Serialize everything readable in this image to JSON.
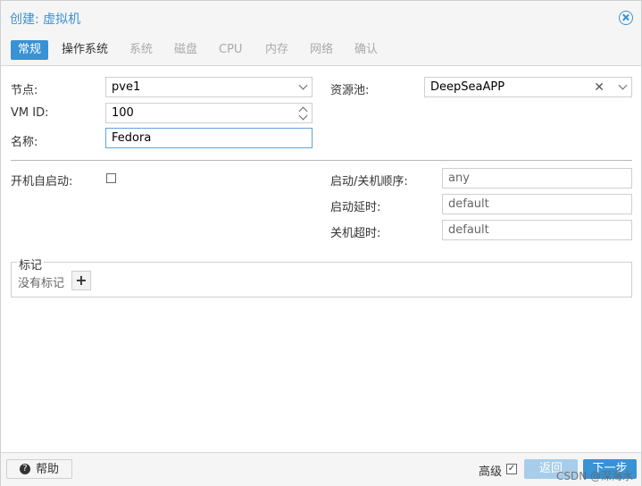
{
  "dialog": {
    "title": "创建: 虚拟机"
  },
  "tabs": [
    {
      "label": "常规",
      "state": "active"
    },
    {
      "label": "操作系统",
      "state": "enabled"
    },
    {
      "label": "系统",
      "state": "disabled"
    },
    {
      "label": "磁盘",
      "state": "disabled"
    },
    {
      "label": "CPU",
      "state": "disabled"
    },
    {
      "label": "内存",
      "state": "disabled"
    },
    {
      "label": "网络",
      "state": "disabled"
    },
    {
      "label": "确认",
      "state": "disabled"
    }
  ],
  "form": {
    "node_label": "节点:",
    "node_value": "pve1",
    "vmid_label": "VM ID:",
    "vmid_value": "100",
    "name_label": "名称:",
    "name_value": "Fedora",
    "pool_label": "资源池:",
    "pool_value": "DeepSeaAPP",
    "onboot_label": "开机自启动:",
    "onboot_checked": false,
    "order_label": "启动/关机顺序:",
    "order_placeholder": "any",
    "startup_delay_label": "启动延时:",
    "startup_delay_placeholder": "default",
    "shutdown_timeout_label": "关机超时:",
    "shutdown_timeout_placeholder": "default"
  },
  "tags": {
    "legend": "标记",
    "empty_text": "没有标记"
  },
  "footer": {
    "help_label": "帮助",
    "advanced_label": "高级",
    "advanced_checked": true,
    "back_label": "返回",
    "next_label": "下一步"
  },
  "watermark": "CSDN @深海水",
  "colors": {
    "accent": "#3892d4",
    "disabled_button": "#a7cdea"
  }
}
